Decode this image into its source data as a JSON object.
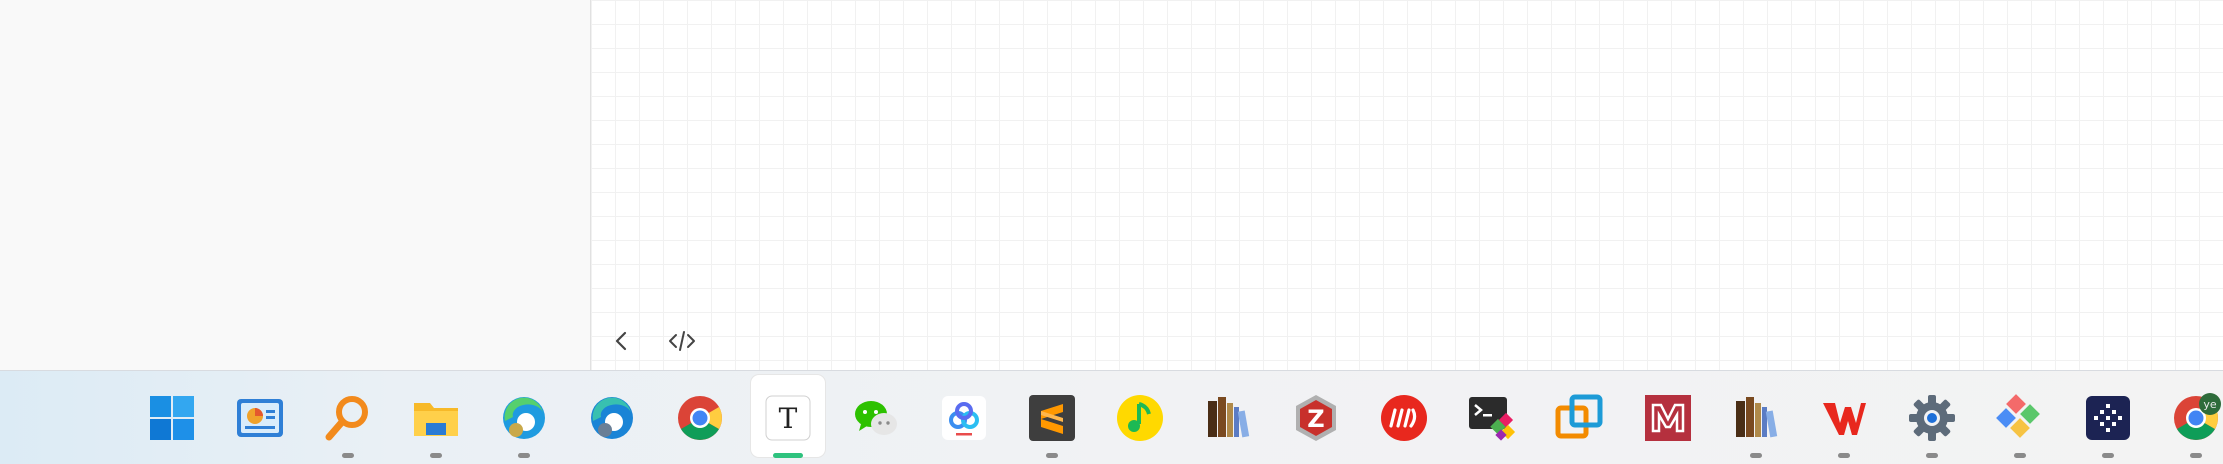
{
  "app": {
    "sidebar": {},
    "canvas": {
      "back_button": {
        "icon": "chevron-left-icon"
      },
      "code_button": {
        "icon": "code-icon"
      }
    }
  },
  "taskbar": {
    "items": [
      {
        "name": "start",
        "icon": "windows-logo-icon",
        "running": false
      },
      {
        "name": "task-view",
        "icon": "widgets-icon",
        "running": false
      },
      {
        "name": "search",
        "icon": "magnifier-icon",
        "running": true
      },
      {
        "name": "file-explorer",
        "icon": "folder-icon",
        "running": true
      },
      {
        "name": "edge-canary",
        "icon": "edge-profile-icon",
        "running": true
      },
      {
        "name": "edge-beta",
        "icon": "edge-profile-icon",
        "running": false
      },
      {
        "name": "chrome",
        "icon": "chrome-icon",
        "running": false
      },
      {
        "name": "typora",
        "icon": "typora-icon",
        "running": true,
        "active": true,
        "label": "T"
      },
      {
        "name": "wechat",
        "icon": "wechat-icon",
        "running": false
      },
      {
        "name": "baidu-netdisk",
        "icon": "cloud-icon",
        "running": false
      },
      {
        "name": "sublime-text",
        "icon": "sublime-icon",
        "running": true
      },
      {
        "name": "qq-music",
        "icon": "music-note-icon",
        "running": false
      },
      {
        "name": "calibre",
        "icon": "books-icon",
        "running": false
      },
      {
        "name": "zotero",
        "icon": "zotero-icon",
        "running": false,
        "label": "Z"
      },
      {
        "name": "app-red",
        "icon": "red-logo-icon",
        "running": false
      },
      {
        "name": "windows-terminal",
        "icon": "terminal-icon",
        "running": false
      },
      {
        "name": "vmware",
        "icon": "vmware-icon",
        "running": false
      },
      {
        "name": "mendeley",
        "icon": "mendeley-icon",
        "running": false
      },
      {
        "name": "calibre-viewer",
        "icon": "books-icon",
        "running": true
      },
      {
        "name": "wps-office",
        "icon": "wps-icon",
        "running": true
      },
      {
        "name": "settings",
        "icon": "gear-icon",
        "running": true
      },
      {
        "name": "git-extensions",
        "icon": "diamond-icon",
        "running": true
      },
      {
        "name": "app-dark",
        "icon": "dotted-diamond-icon",
        "running": true
      },
      {
        "name": "chrome-profile",
        "icon": "chrome-icon",
        "running": true,
        "label": "ye"
      }
    ]
  },
  "colors": {
    "accent": "#2ec27e",
    "taskbar_bg": "#f3f3f3",
    "canvas_grid": "#f1f1f1"
  }
}
